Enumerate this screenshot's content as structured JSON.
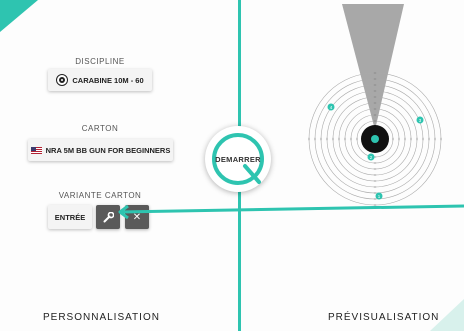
{
  "left_panel": {
    "discipline_label": "DISCIPLINE",
    "discipline_value": "CARABINE 10M - 60",
    "carton_label": "CARTON",
    "carton_value": "NRA 5M BB GUN FOR BEGINNERS",
    "variante_label": "VARIANTE CARTON",
    "variante_value": "ENTRÉE",
    "footer": "PERSONNALISATION"
  },
  "center": {
    "start_label": "DEMARRER"
  },
  "right_panel": {
    "footer": "PRÉVISUALISATION",
    "markers": [
      "4",
      "3",
      "2",
      "1"
    ]
  },
  "colors": {
    "accent": "#2ec4b0",
    "dark_button": "#5a5a5a"
  },
  "icons": [
    "target-icon",
    "us-flag-icon",
    "wrench-icon",
    "close-icon",
    "q-logo-icon"
  ]
}
